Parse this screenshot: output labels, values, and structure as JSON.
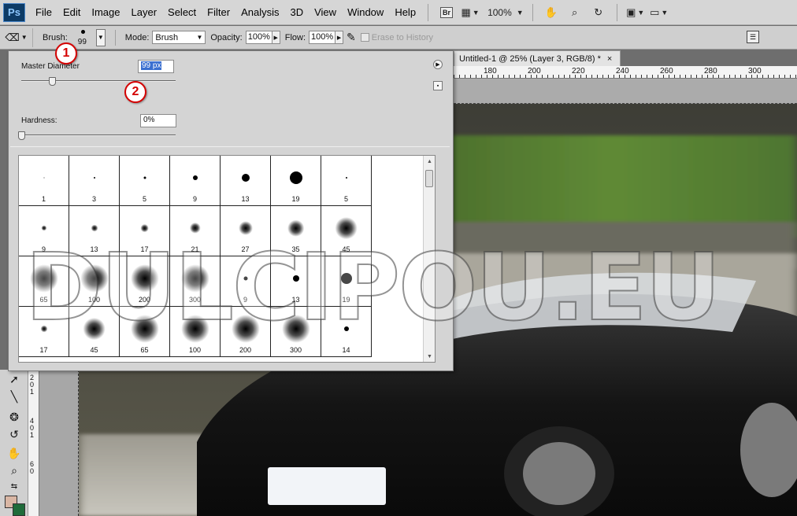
{
  "app": {
    "logo": "Ps"
  },
  "menubar": {
    "items": [
      "File",
      "Edit",
      "Image",
      "Layer",
      "Select",
      "Filter",
      "Analysis",
      "3D",
      "View",
      "Window",
      "Help"
    ],
    "bridge_label": "Br",
    "zoom": "100%",
    "icons": [
      "bridge-icon",
      "frame-view-icon",
      "hand-icon",
      "zoom-icon",
      "rotate-icon",
      "arrange-icon",
      "screen-mode-icon"
    ]
  },
  "options": {
    "brush_label": "Brush:",
    "brush_size": "99",
    "mode_label": "Mode:",
    "mode_value": "Brush",
    "opacity_label": "Opacity:",
    "opacity_value": "100%",
    "flow_label": "Flow:",
    "flow_value": "100%",
    "erase_history_label": "Erase to History"
  },
  "document": {
    "tab_title": "Untitled-1 @ 25% (Layer 3, RGB/8) *",
    "close_symbol": "×",
    "ruler_labels": [
      "180",
      "200",
      "220",
      "240",
      "260",
      "280",
      "300"
    ],
    "left_ruler_labels": [
      "2",
      "0",
      "1",
      "4",
      "0",
      "1",
      "6",
      "0"
    ]
  },
  "brush_picker": {
    "master_diameter_label": "Master Diameter",
    "master_diameter_value": "99 px",
    "master_diameter_fraction": 0.2,
    "hardness_label": "Hardness:",
    "hardness_value": "0%",
    "hardness_fraction": 0.0,
    "presets": [
      {
        "size": "1",
        "tip": 1,
        "soft": false
      },
      {
        "size": "3",
        "tip": 2,
        "soft": false
      },
      {
        "size": "5",
        "tip": 3,
        "soft": false
      },
      {
        "size": "9",
        "tip": 6,
        "soft": false
      },
      {
        "size": "13",
        "tip": 10,
        "soft": false
      },
      {
        "size": "19",
        "tip": 16,
        "soft": false
      },
      {
        "size": "5",
        "tip": 2,
        "soft": false
      },
      {
        "size": "9",
        "tip": 4,
        "soft": true
      },
      {
        "size": "13",
        "tip": 5,
        "soft": true
      },
      {
        "size": "17",
        "tip": 6,
        "soft": true
      },
      {
        "size": "21",
        "tip": 8,
        "soft": true
      },
      {
        "size": "27",
        "tip": 10,
        "soft": true
      },
      {
        "size": "35",
        "tip": 12,
        "soft": true
      },
      {
        "size": "45",
        "tip": 16,
        "soft": true
      },
      {
        "size": "65",
        "tip": 20,
        "soft": true
      },
      {
        "size": "100",
        "tip": 20,
        "soft": true
      },
      {
        "size": "200",
        "tip": 20,
        "soft": true
      },
      {
        "size": "300",
        "tip": 20,
        "soft": true
      },
      {
        "size": "9",
        "tip": 5,
        "soft": false
      },
      {
        "size": "13",
        "tip": 8,
        "soft": false
      },
      {
        "size": "19",
        "tip": 14,
        "soft": false
      },
      {
        "size": "17",
        "tip": 5,
        "soft": true
      },
      {
        "size": "45",
        "tip": 16,
        "soft": true
      },
      {
        "size": "65",
        "tip": 20,
        "soft": true
      },
      {
        "size": "100",
        "tip": 20,
        "soft": true
      },
      {
        "size": "200",
        "tip": 20,
        "soft": true
      },
      {
        "size": "300",
        "tip": 20,
        "soft": true
      },
      {
        "size": "14",
        "tip": 6,
        "soft": false
      }
    ]
  },
  "callouts": [
    "1",
    "2"
  ],
  "colors": {
    "foreground": "#d9b6a4",
    "background": "#1f6b3a"
  },
  "watermark": "DULCIPOU.EU"
}
